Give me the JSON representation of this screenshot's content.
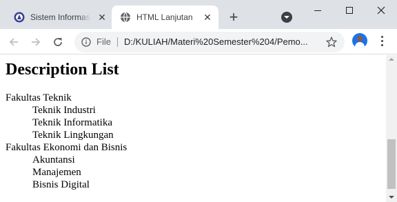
{
  "browser": {
    "tabs": [
      {
        "title": "Sistem Informasi",
        "favicon": "university-logo-icon",
        "active": false
      },
      {
        "title": "HTML Lanjutan",
        "favicon": "globe-icon",
        "active": true
      }
    ],
    "address_bar": {
      "scheme_label": "File",
      "url": "D:/KULIAH/Materi%20Semester%204/Pemo..."
    }
  },
  "page": {
    "heading": "Description List",
    "description_list": [
      {
        "term": "Fakultas Teknik",
        "details": [
          "Teknik Industri",
          "Teknik Informatika",
          "Teknik Lingkungan"
        ]
      },
      {
        "term": "Fakultas Ekonomi dan Bisnis",
        "details": [
          "Akuntansi",
          "Manajemen",
          "Bisnis Digital"
        ]
      }
    ]
  },
  "colors": {
    "tabstrip_bg": "#dee1e6",
    "omnibox_bg": "#f1f3f4",
    "accent": "#1a73e8"
  }
}
